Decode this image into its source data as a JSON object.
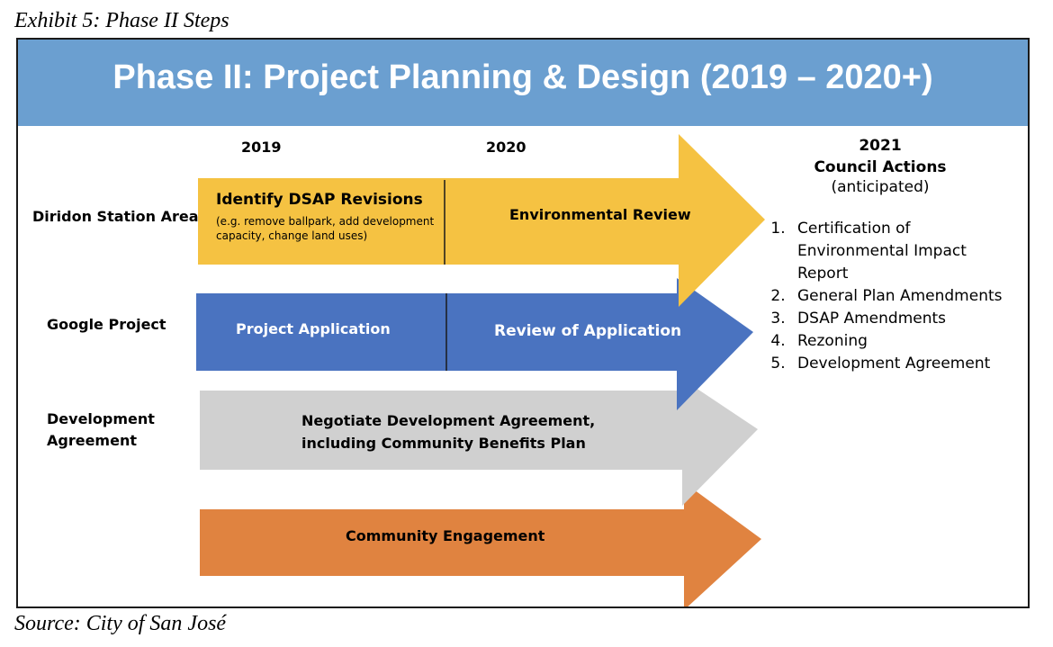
{
  "exhibit_title": "Exhibit 5: Phase II Steps",
  "banner_title": "Phase II: Project Planning & Design (2019 – 2020+)",
  "years": {
    "y2019": "2019",
    "y2020": "2020",
    "y2021": "2021"
  },
  "rows": {
    "diridon": "Diridon Station Area",
    "google": "Google Project",
    "devagreement": "Development Agreement"
  },
  "bars": {
    "dsap_title": "Identify DSAP Revisions",
    "dsap_detail": "(e.g. remove ballpark, add development capacity, change land uses)",
    "env_review": "Environmental Review",
    "project_application": "Project Application",
    "review_application": "Review of Application",
    "negotiate_line1": "Negotiate Development Agreement,",
    "negotiate_line2": "including Community Benefits Plan",
    "community": "Community Engagement"
  },
  "council": {
    "title": "Council Actions",
    "subtitle": "(anticipated)",
    "items": [
      "Certification of Environmental Impact Report",
      "General Plan Amendments",
      "DSAP Amendments",
      "Rezoning",
      "Development Agreement"
    ]
  },
  "source": "Source: City of San José",
  "colors": {
    "banner": "#6b9fd0",
    "yellow": "#f5c242",
    "blue": "#4a73c0",
    "gray": "#d0d0d0",
    "orange": "#e08340"
  }
}
